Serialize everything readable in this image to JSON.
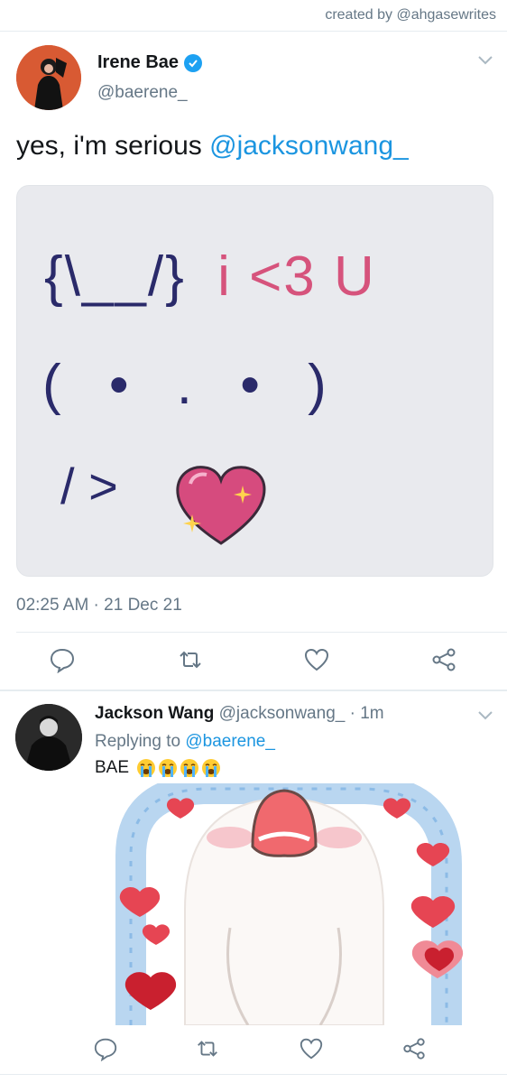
{
  "credit": "created by @ahgasewrites",
  "main_tweet": {
    "name": "Irene Bae",
    "handle": "@baerene_",
    "text_plain": "yes, i'm serious ",
    "text_mention": "@jacksonwang_",
    "media_text": {
      "line1_left": "{\\__/}",
      "line1_right": "i <3 U",
      "line2": "( • . • )",
      "line3": "/ >"
    },
    "timestamp": "02:25 AM · 21 Dec 21",
    "actions": [
      "reply-icon",
      "retweet-icon",
      "like-icon",
      "share-icon"
    ]
  },
  "reply_tweet": {
    "name": "Jackson Wang",
    "handle": "@jacksonwang_",
    "time": "· 1m",
    "replying_prefix": "Replying to ",
    "replying_to": "@baerene_",
    "text": "BAE",
    "emoji": [
      "loudly-crying-face-icon",
      "loudly-crying-face-icon",
      "loudly-crying-face-icon",
      "loudly-crying-face-icon"
    ],
    "actions": [
      "reply-icon",
      "retweet-icon",
      "like-icon",
      "share-icon"
    ]
  },
  "colors": {
    "link": "#1b95e0",
    "muted": "#657786",
    "verified": "#1da1f2",
    "heart_pink": "#d64b7e",
    "media_bg": "#e9eaee"
  }
}
